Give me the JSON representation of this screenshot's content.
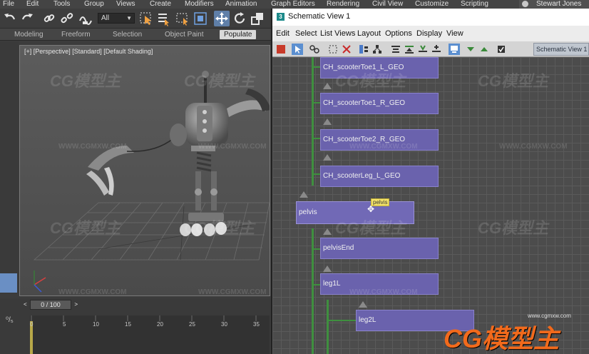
{
  "app": {
    "menu": [
      "File",
      "Edit",
      "Tools",
      "Group",
      "Views",
      "Create",
      "Modifiers",
      "Animation",
      "Graph Editors",
      "Rendering",
      "Civil View",
      "Customize",
      "Scripting"
    ],
    "user": "Stewart Jones"
  },
  "toolbar": {
    "filter_value": "All",
    "icons": [
      "undo-icon",
      "redo-icon",
      "link-icon",
      "unlink-icon",
      "bind-spacewarp-icon",
      "select-object-icon",
      "select-by-name-icon",
      "rect-selection-icon",
      "window-crossing-icon",
      "move-icon",
      "rotate-icon",
      "scale-icon"
    ]
  },
  "ribbon": {
    "tabs": [
      "Modeling",
      "Freeform",
      "Selection",
      "Object Paint",
      "Populate"
    ],
    "active_tab": "Populate"
  },
  "viewport": {
    "label": "[+] [Perspective] [Standard] [Default Shading]"
  },
  "timeline": {
    "slider_text": "0 / 100",
    "ticks": [
      "0",
      "5",
      "10",
      "15",
      "20",
      "25",
      "30",
      "35"
    ]
  },
  "schematic": {
    "title": "Schematic View 1",
    "menu": [
      "Edit",
      "Select",
      "List Views",
      "Layout",
      "Options",
      "Display",
      "View"
    ],
    "name_field": "Schematic View 1",
    "nodes": [
      {
        "label": "CH_scooterToe1_L_GEO"
      },
      {
        "label": "CH_scooterToe1_R_GEO"
      },
      {
        "label": "CH_scooterToe2_R_GEO"
      },
      {
        "label": "CH_scooterLeg_L_GEO"
      },
      {
        "label": "pelvis"
      },
      {
        "label": "pelvisEnd"
      },
      {
        "label": "leg1L"
      },
      {
        "label": "leg2L"
      }
    ],
    "tooltip": "pelvis",
    "accent": "#6a62ad"
  },
  "watermark": {
    "logo": "CG模型主",
    "url": "WWW.CGMXW.COM",
    "corner_small": "www.cgmxw.com",
    "corner_big": "CG模型主"
  }
}
